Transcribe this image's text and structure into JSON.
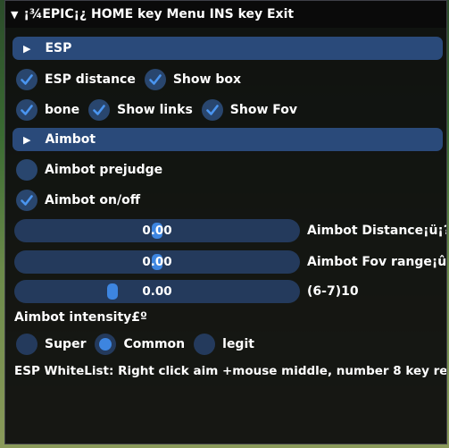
{
  "window": {
    "title": "¡¾EPIC¡¿ HOME key Menu INS key Exit"
  },
  "sections": {
    "esp": "ESP",
    "aimbot": "Aimbot"
  },
  "checkboxes": {
    "esp_distance": {
      "label": "ESP distance",
      "checked": true
    },
    "show_box": {
      "label": "Show box",
      "checked": true
    },
    "bone": {
      "label": "bone",
      "checked": true
    },
    "show_links": {
      "label": "Show links",
      "checked": true
    },
    "show_fov": {
      "label": "Show Fov",
      "checked": true
    },
    "aimbot_prejudge": {
      "label": "Aimbot prejudge",
      "checked": false
    },
    "aimbot_onoff": {
      "label": "Aimbot on/off",
      "checked": true
    }
  },
  "sliders": [
    {
      "value": "0.00",
      "label": "Aimbot Distance¡ü¡?",
      "fraction": 0.5
    },
    {
      "value": "0.00",
      "label": "Aimbot Fov range¡û",
      "fraction": 0.5
    },
    {
      "value": "0.00",
      "label": "(6-7)10",
      "fraction": 0.35
    }
  ],
  "intensity": {
    "label": "Aimbot intensity£º",
    "options": [
      "Super",
      "Common",
      "legit"
    ],
    "selected": "Common"
  },
  "footer": "ESP WhiteList: Right click aim +mouse middle, number 8  key re",
  "colors": {
    "window_bg": "#0f0f0f",
    "header_bg": "#2a4a7a",
    "frame_bg": "#29466e",
    "accent": "#3d85e0"
  }
}
